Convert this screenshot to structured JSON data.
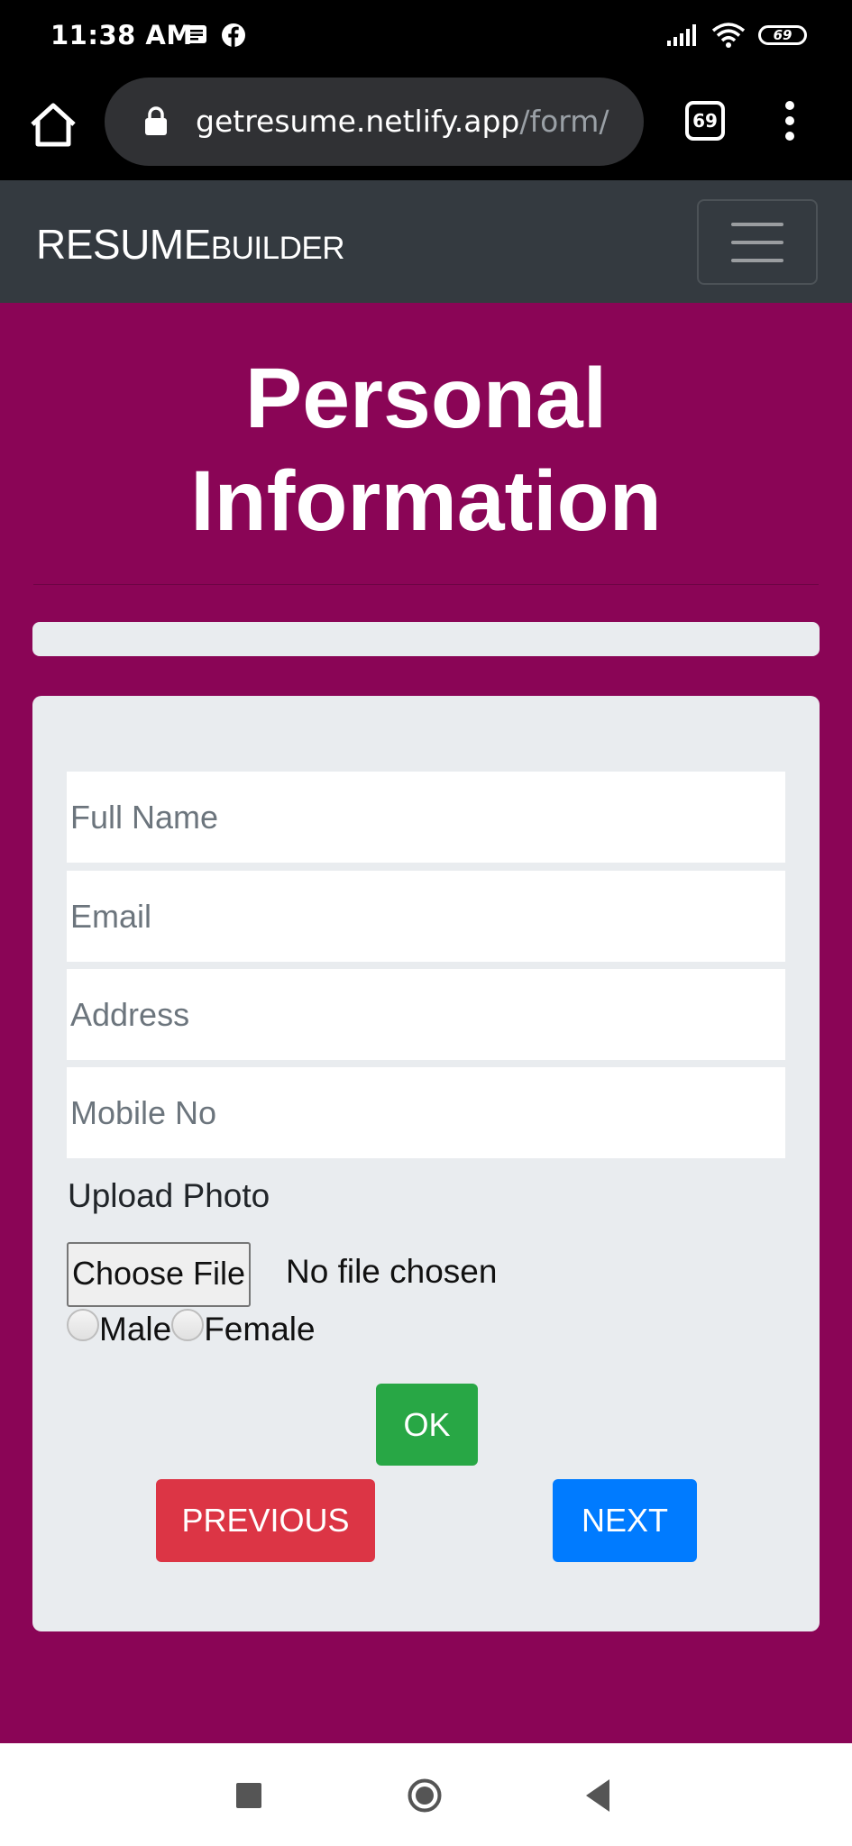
{
  "status_bar": {
    "time": "11:38 AM",
    "battery": "69",
    "icons": [
      "news-icon",
      "facebook-icon",
      "signal-icon",
      "wifi-icon",
      "battery-icon"
    ]
  },
  "browser": {
    "url_host": "getresume.netlify.app",
    "url_path": "/form/",
    "tab_count": "69"
  },
  "navbar": {
    "brand_main": "RESUME",
    "brand_sub": "BUILDER"
  },
  "main": {
    "title_line1": "Personal",
    "title_line2": "Information",
    "progress": 0
  },
  "form": {
    "full_name_placeholder": "Full Name",
    "email_placeholder": "Email",
    "address_placeholder": "Address",
    "mobile_placeholder": "Mobile No",
    "upload_label": "Upload Photo",
    "choose_file_label": "Choose File",
    "file_status": "No file chosen",
    "gender_male": "Male",
    "gender_female": "Female",
    "ok_label": "OK",
    "previous_label": "PREVIOUS",
    "next_label": "NEXT"
  },
  "colors": {
    "page_bg": "#8a0556",
    "navbar_bg": "#343a40",
    "card_bg": "#e9ecef",
    "ok": "#28a745",
    "previous": "#dc3545",
    "next": "#007bff"
  }
}
